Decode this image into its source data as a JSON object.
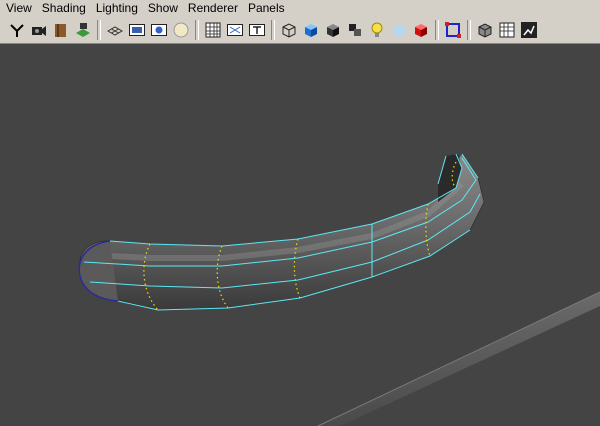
{
  "menubar": {
    "items": [
      "View",
      "Shading",
      "Lighting",
      "Show",
      "Renderer",
      "Panels"
    ]
  },
  "toolbar": {
    "groups": [
      [
        "select-camera-icon",
        "camera-attributes-icon",
        "bookmarks-icon",
        "image-plane-icon"
      ],
      [
        "grid-icon",
        "film-gate-icon",
        "resolution-gate-icon",
        "gate-mask-icon"
      ],
      [
        "field-chart-icon",
        "safe-action-icon",
        "safe-title-icon"
      ],
      [
        "wireframe-icon",
        "smooth-shade-icon",
        "flat-shade-icon",
        "bounding-box-icon",
        "use-default-light-icon",
        "xray-icon",
        "textured-icon"
      ],
      [
        "isolate-select-icon"
      ],
      [
        "shaded-wireframe-icon",
        "frame-all-icon",
        "hud-toggle-icon"
      ]
    ]
  },
  "viewport": {
    "background": "#444444",
    "object": "curved-pipe-mesh",
    "wireframe_color": "#5ee7f5",
    "selected_edge_color": "#2b2a9a",
    "seam_color": "#f5e000"
  }
}
